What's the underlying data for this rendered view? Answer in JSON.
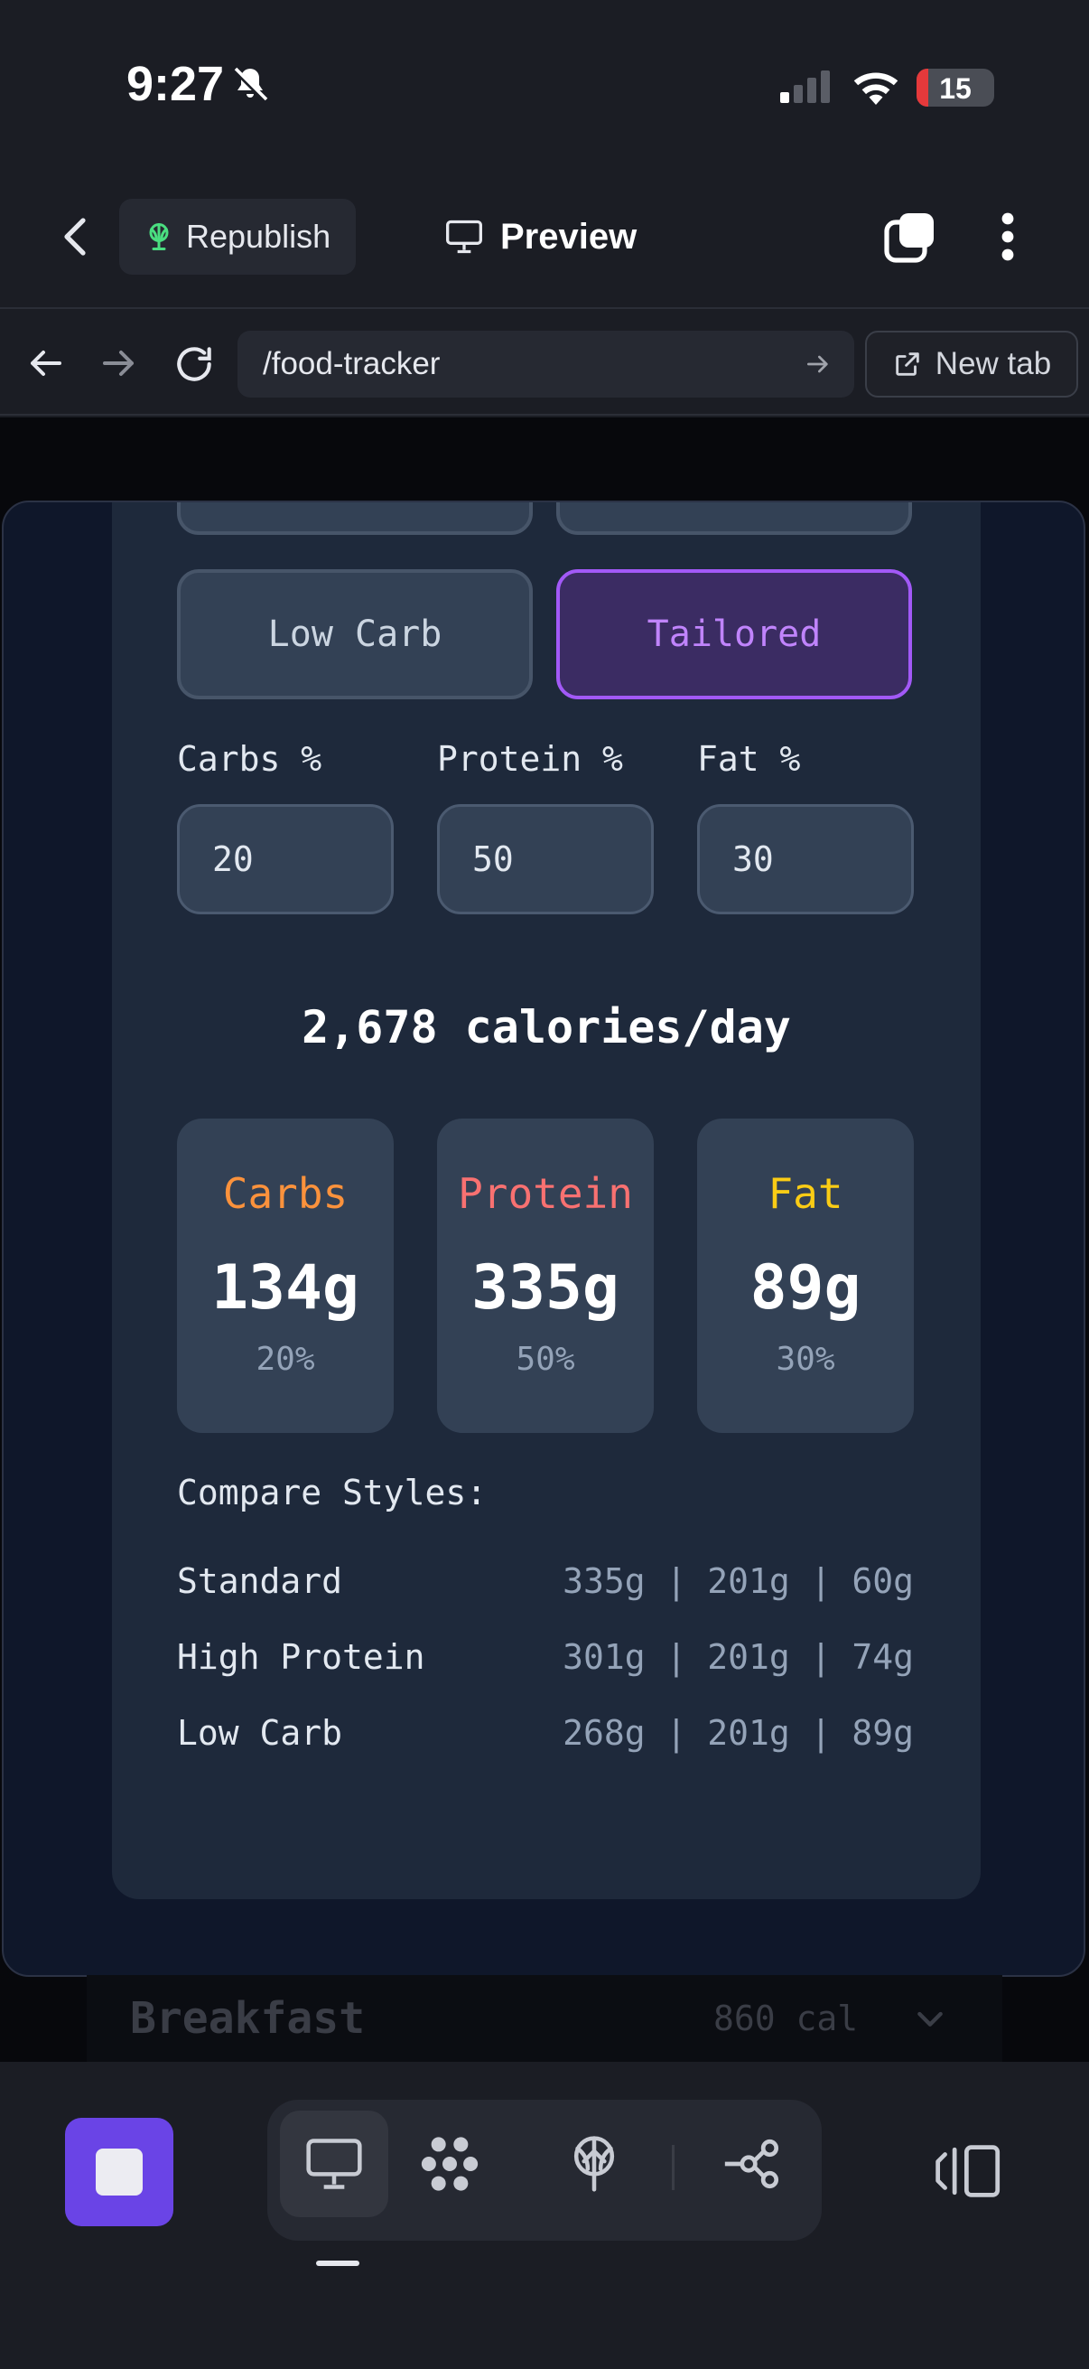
{
  "status_bar": {
    "time": "9:27",
    "battery_level": "15",
    "battery_fraction": 0.15
  },
  "app_bar": {
    "republish_label": "Republish",
    "preview_label": "Preview"
  },
  "browser": {
    "url": "/food-tracker",
    "new_tab_label": "New tab"
  },
  "diet_styles": {
    "low_carb_label": "Low Carb",
    "tailored_label": "Tailored",
    "selected": "Tailored"
  },
  "inputs": {
    "carbs_label": "Carbs %",
    "carbs_value": "20",
    "protein_label": "Protein %",
    "protein_value": "50",
    "fat_label": "Fat %",
    "fat_value": "30"
  },
  "calorie_total": "2,678 calories/day",
  "macros": [
    {
      "name": "Carbs",
      "grams": "134g",
      "percent": "20%",
      "color": "#fb923c"
    },
    {
      "name": "Protein",
      "grams": "335g",
      "percent": "50%",
      "color": "#f87171"
    },
    {
      "name": "Fat",
      "grams": "89g",
      "percent": "30%",
      "color": "#facc15"
    }
  ],
  "compare": {
    "title": "Compare Styles:",
    "rows": [
      {
        "label": "Standard",
        "values": "335g | 201g | 60g"
      },
      {
        "label": "High Protein",
        "values": "301g | 201g | 74g"
      },
      {
        "label": "Low Carb",
        "values": "268g | 201g | 89g"
      }
    ]
  },
  "meal": {
    "title": "Breakfast",
    "calories": "860 cal"
  },
  "colors": {
    "accent_purple": "#a259f7",
    "stop_button": "#6a44e6"
  }
}
